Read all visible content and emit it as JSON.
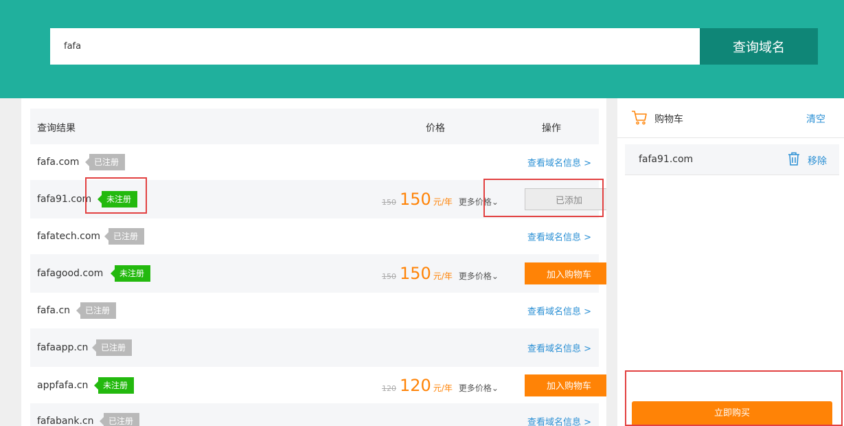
{
  "search": {
    "value": "fafa",
    "button_label": "查询域名"
  },
  "table": {
    "col_result": "查询结果",
    "col_price": "价格",
    "col_action": "操作",
    "rows": [
      {
        "name": "fafa.com",
        "status": "已注册",
        "link": "查看域名信息 >"
      },
      {
        "name": "fafa91.com",
        "status": "未注册",
        "old_price": "150",
        "price": "150",
        "unit": "元/年",
        "more": "更多价格",
        "action": "已添加"
      },
      {
        "name": "fafatech.com",
        "status": "已注册",
        "link": "查看域名信息 >"
      },
      {
        "name": "fafagood.com",
        "status": "未注册",
        "old_price": "150",
        "price": "150",
        "unit": "元/年",
        "more": "更多价格",
        "action": "加入购物车"
      },
      {
        "name": "fafa.cn",
        "status": "已注册",
        "link": "查看域名信息 >"
      },
      {
        "name": "fafaapp.cn",
        "status": "已注册",
        "link": "查看域名信息 >"
      },
      {
        "name": "appfafa.cn",
        "status": "未注册",
        "old_price": "120",
        "price": "120",
        "unit": "元/年",
        "more": "更多价格",
        "action": "加入购物车"
      },
      {
        "name": "fafabank.cn",
        "status": "已注册",
        "link": "查看域名信息 >"
      }
    ]
  },
  "cart": {
    "title": "购物车",
    "clear": "清空",
    "items": [
      {
        "name": "fafa91.com",
        "remove": "移除"
      }
    ],
    "buy": "立即购买"
  },
  "colors": {
    "header": "#20b09d",
    "search_button": "#0f8677",
    "accent": "#ff8306",
    "link": "#2a8fd4",
    "registered": "#b9b9b9",
    "available": "#23b90e",
    "highlight": "#e24040"
  },
  "icons": {
    "cart": "cart-icon",
    "trash": "trash-icon",
    "chevron": "chevron-down-icon"
  }
}
